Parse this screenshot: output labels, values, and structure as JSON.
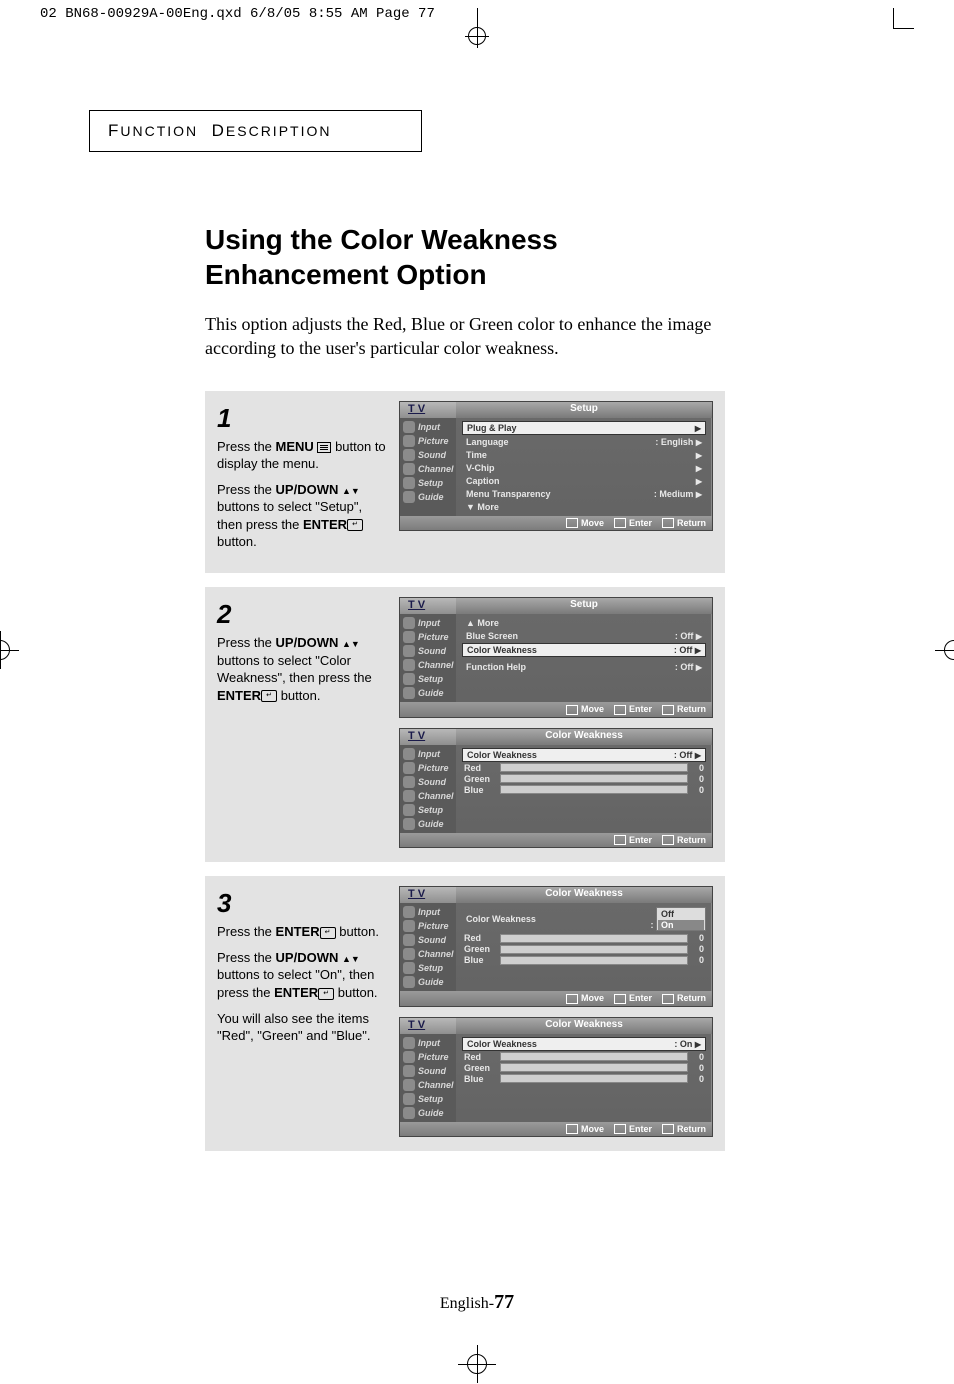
{
  "print_header": "02 BN68-00929A-00Eng.qxd  6/8/05 8:55 AM  Page 77",
  "section_tab": "Function Description",
  "page_title_l1": "Using the Color Weakness",
  "page_title_l2": "Enhancement Option",
  "intro": "This option adjusts the Red, Blue or Green color to enhance the image according to the user's particular color weakness.",
  "footer_lang": "English-",
  "footer_page": "77",
  "steps": {
    "s1": {
      "num": "1",
      "p1a": "Press the ",
      "p1b": "MENU",
      "p1c": " button to display the menu.",
      "p2a": "Press the ",
      "p2b": "UP/DOWN",
      "p2c": " buttons to select \"Setup\", then press the ",
      "p2d": "ENTER",
      "p2e": " button."
    },
    "s2": {
      "num": "2",
      "p1a": "Press the ",
      "p1b": "UP/DOWN",
      "p1c": " buttons  to select \"Color Weakness\", then press the ",
      "p1d": "ENTER",
      "p1e": " button."
    },
    "s3": {
      "num": "3",
      "p1a": "Press the ",
      "p1b": "ENTER",
      "p1c": " button.",
      "p2a": "Press the ",
      "p2b": "UP/DOWN",
      "p2c": " buttons to select \"On\", then press the ",
      "p2d": "ENTER",
      "p2e": "  button.",
      "p3": "You will also see the items \"Red\", \"Green\" and \"Blue\"."
    }
  },
  "osd": {
    "tv": "T V",
    "side": [
      "Input",
      "Picture",
      "Sound",
      "Channel",
      "Setup",
      "Guide"
    ],
    "foot_move": "Move",
    "foot_enter": "Enter",
    "foot_return": "Return",
    "setup_title": "Setup",
    "cw_title": "Color Weakness",
    "s1_rows": [
      {
        "l": "Plug & Play",
        "r": "",
        "sel": true
      },
      {
        "l": "Language",
        "r": ": English"
      },
      {
        "l": "Time",
        "r": ""
      },
      {
        "l": "V-Chip",
        "r": ""
      },
      {
        "l": "Caption",
        "r": ""
      },
      {
        "l": "Menu Transparency",
        "r": ": Medium"
      },
      {
        "l": "▼ More",
        "r": ""
      }
    ],
    "s2a_rows": [
      {
        "l": "▲ More",
        "r": ""
      },
      {
        "l": "Blue Screen",
        "r": ": Off"
      },
      {
        "l": "Color Weakness",
        "r": ": Off",
        "sel": true
      },
      {
        "l": "",
        "r": ""
      },
      {
        "l": "Function Help",
        "r": ": Off"
      }
    ],
    "cw_off": {
      "label": "Color Weakness",
      "val": ": Off"
    },
    "cw_on": {
      "label": "Color Weakness",
      "val": ": On"
    },
    "rgb": [
      {
        "lbl": "Red",
        "val": "0"
      },
      {
        "lbl": "Green",
        "val": "0"
      },
      {
        "lbl": "Blue",
        "val": "0"
      }
    ],
    "dd_off": "Off",
    "dd_on": "On"
  }
}
